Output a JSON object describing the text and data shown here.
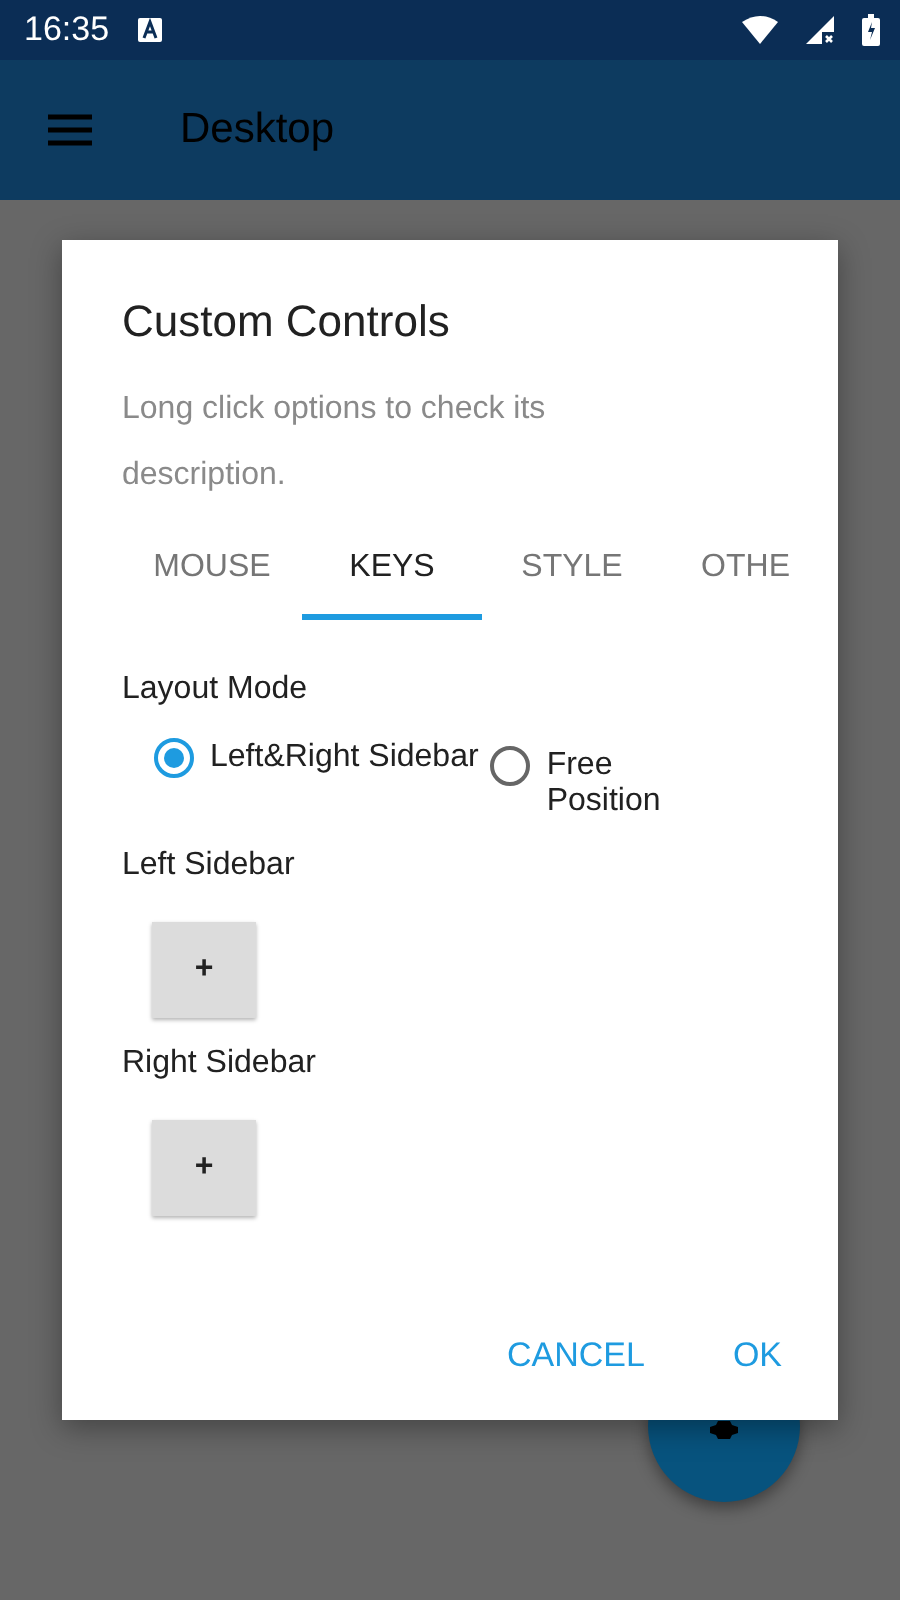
{
  "status_bar": {
    "time": "16:35"
  },
  "app_bar": {
    "title": "Desktop"
  },
  "dialog": {
    "title": "Custom Controls",
    "subtitle": "Long click options to check its description.",
    "tabs": [
      {
        "label": "MOUSE",
        "selected": false
      },
      {
        "label": "KEYS",
        "selected": true
      },
      {
        "label": "STYLE",
        "selected": false
      },
      {
        "label": "OTHE",
        "selected": false
      }
    ],
    "layout_mode": {
      "label": "Layout Mode",
      "options": [
        {
          "label": "Left&Right Sidebar",
          "selected": true
        },
        {
          "label": "Free Position",
          "selected": false
        }
      ]
    },
    "sections": [
      {
        "label": "Left Sidebar",
        "button": "+"
      },
      {
        "label": "Right Sidebar",
        "button": "+"
      }
    ],
    "buttons": [
      "CANCEL",
      "OK"
    ]
  }
}
